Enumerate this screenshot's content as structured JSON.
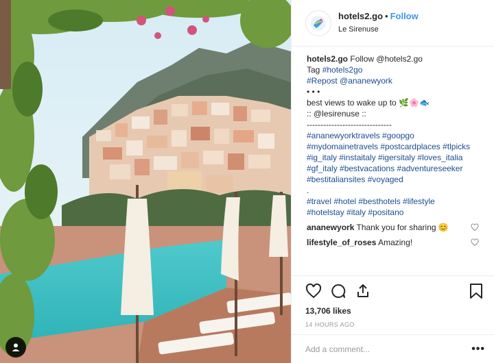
{
  "header": {
    "username": "hotels2.go",
    "separator": "•",
    "follow_label": "Follow",
    "location": "Le Sirenuse"
  },
  "caption": {
    "line1_user": "hotels2.go",
    "line1_follow": "Follow",
    "line1_handle": "@hotels2.go",
    "line2_prefix": "Tag",
    "line2_tag": "#hotels2go",
    "line3": "#Repost @ananewyork",
    "line4": "•  •  •",
    "line5": "best views to wake up to 🌿🌸🐟",
    "line6": ":: @lesirenuse ::",
    "line7": "-------------------------------",
    "line8": "#ananewyorktravels #goopgo",
    "line9": "#mydomainetravels #postcardplaces #tlpicks",
    "line10": "#ig_italy #instaitaly #igersitaly #loves_italia",
    "line11": "#gf_italy #bestvacations #adventureseeker",
    "line12": "#bestitaliansites #voyaged",
    "line13": ".",
    "line14": "#travel #hotel #besthotels #lifestyle",
    "line15": "#hotelstay #italy #positano"
  },
  "comments": [
    {
      "user": "ananewyork",
      "text": "Thank you for sharing 😊"
    },
    {
      "user": "lifestyle_of_roses",
      "text": "Amazing!"
    }
  ],
  "likes": "13,706 likes",
  "timestamp": "14 HOURS AGO",
  "add_comment_placeholder": "Add a comment...",
  "more_label": "•••",
  "icons": {
    "like": "heart-icon",
    "comment": "comment-icon",
    "share": "share-icon",
    "save": "bookmark-icon",
    "tag": "user-tag-icon"
  },
  "colors": {
    "follow": "#3897f0",
    "hashtag": "#1a4c8f",
    "muted": "#999999"
  }
}
